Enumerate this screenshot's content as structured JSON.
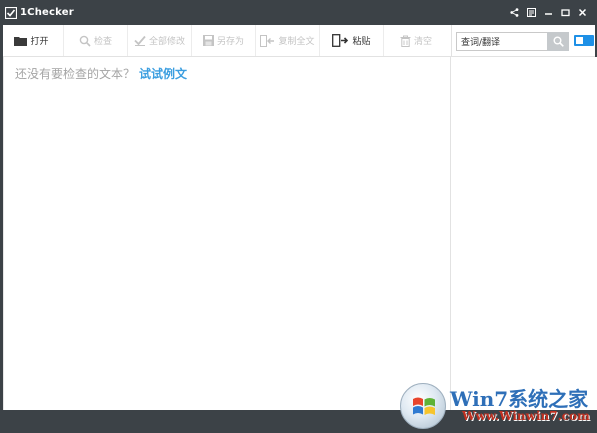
{
  "window": {
    "title": "1Checker",
    "controls": [
      {
        "name": "share-icon"
      },
      {
        "name": "menu-icon"
      },
      {
        "name": "minimize-icon"
      },
      {
        "name": "maximize-icon"
      },
      {
        "name": "close-icon"
      }
    ]
  },
  "toolbar": {
    "open_label": "打开",
    "check_label": "检查",
    "fix_all_label": "全部修改",
    "save_as_label": "另存为",
    "copy_all_label": "复制全文",
    "paste_label": "粘贴",
    "clear_label": "清空"
  },
  "search": {
    "value": "查词/翻译",
    "placeholder": "查词/翻译"
  },
  "editor": {
    "prompt": "还没有要检查的文本？",
    "try_link": "试试例文"
  },
  "watermark": {
    "title": "Win7系统之家",
    "url": "Www.Winwin7.com"
  },
  "colors": {
    "titlebar": "#3c4247",
    "accent": "#1e90e6",
    "link": "#3b9ee0",
    "disabled_text": "#c4c4c4"
  }
}
